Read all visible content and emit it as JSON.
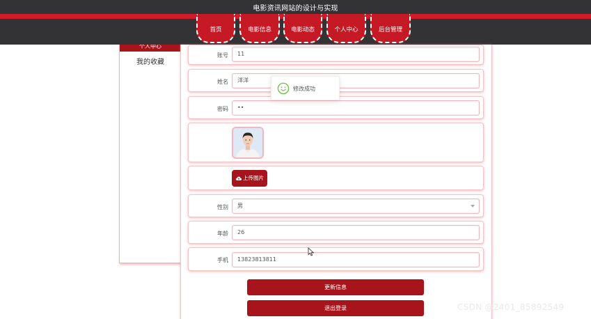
{
  "header": {
    "site_title": "电影资讯网站的设计与实现",
    "nav": [
      {
        "label": "首页"
      },
      {
        "label": "电影信息"
      },
      {
        "label": "电影动态"
      },
      {
        "label": "个人中心"
      },
      {
        "label": "后台管理"
      }
    ]
  },
  "sidebar": {
    "active_label": "个人中心",
    "items": [
      {
        "label": "我的收藏"
      }
    ]
  },
  "form": {
    "account": {
      "label": "账号",
      "value": "11"
    },
    "name": {
      "label": "姓名",
      "value": "洋洋"
    },
    "password": {
      "label": "密码",
      "value": "••"
    },
    "upload_label": "上传图片",
    "gender": {
      "label": "性别",
      "value": "男"
    },
    "age": {
      "label": "年龄",
      "value": "26"
    },
    "phone": {
      "label": "手机",
      "value": "13823813811"
    }
  },
  "toast": {
    "message": "修改成功"
  },
  "actions": {
    "update_label": "更新信息",
    "logout_label": "退出登录"
  },
  "watermark": "CSDN @2401_85892549",
  "colors": {
    "topbar": "#333335",
    "accent_red": "#c51a26",
    "button_red": "#a8141b",
    "success_green": "#67c23a"
  }
}
